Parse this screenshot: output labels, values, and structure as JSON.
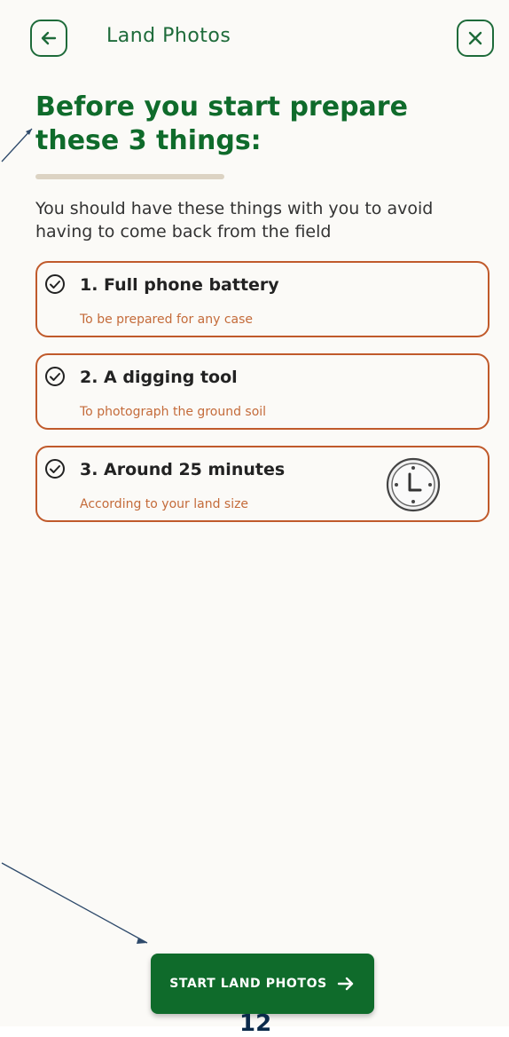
{
  "topbar": {
    "title": "Land Photos",
    "back_icon": "arrow-left-icon",
    "close_icon": "close-icon"
  },
  "main": {
    "headline": "Before you start prepare these 3 things:",
    "subtext": "You should have these things with you to avoid having to come back from the field",
    "items": [
      {
        "title": "1. Full phone battery",
        "description": "To be prepared for any case",
        "icon": "check-circle-icon"
      },
      {
        "title": "2. A digging tool",
        "description": "To photograph the ground soil",
        "icon": "check-circle-icon"
      },
      {
        "title": "3. Around 25 minutes",
        "description": "According to your land size",
        "icon": "check-circle-icon",
        "extra_icon": "clock-icon"
      }
    ]
  },
  "footer": {
    "cta_label": "START LAND PHOTOS",
    "cta_icon": "arrow-right-icon",
    "page_number": "12"
  },
  "colors": {
    "brand_green": "#0f6b2b",
    "accent_orange": "#c05a2b",
    "background": "#fbfaf7",
    "divider": "#dcd3c3"
  }
}
